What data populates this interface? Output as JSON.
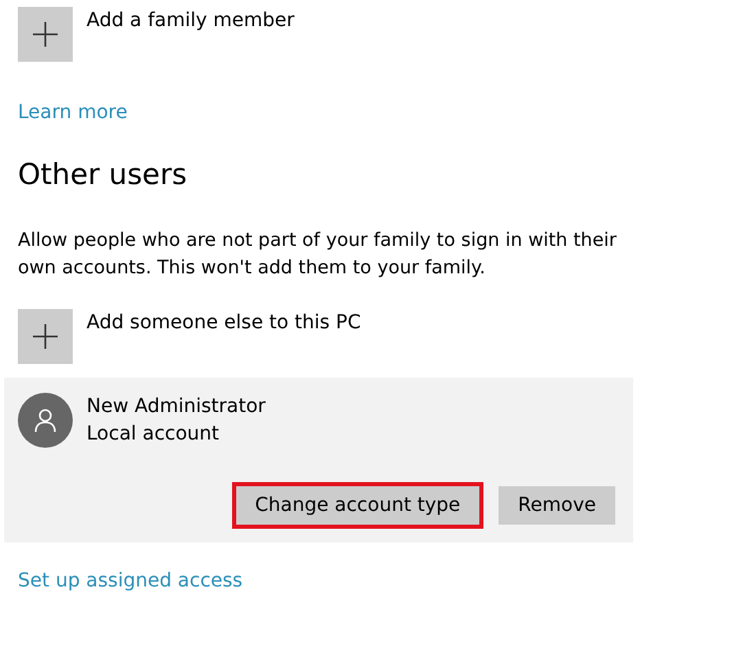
{
  "family": {
    "add_label": "Add a family member",
    "link": "Learn more"
  },
  "other_users": {
    "heading": "Other users",
    "description": "Allow people who are not part of your family to sign in with their own accounts. This won't add them to your family.",
    "add_label": "Add someone else to this PC",
    "accounts": [
      {
        "name": "New Administrator",
        "type": "Local account",
        "selected": true,
        "buttons": [
          {
            "label": "Change account type",
            "highlighted": true
          },
          {
            "label": "Remove",
            "highlighted": false
          }
        ]
      }
    ],
    "link": "Set up assigned access"
  }
}
